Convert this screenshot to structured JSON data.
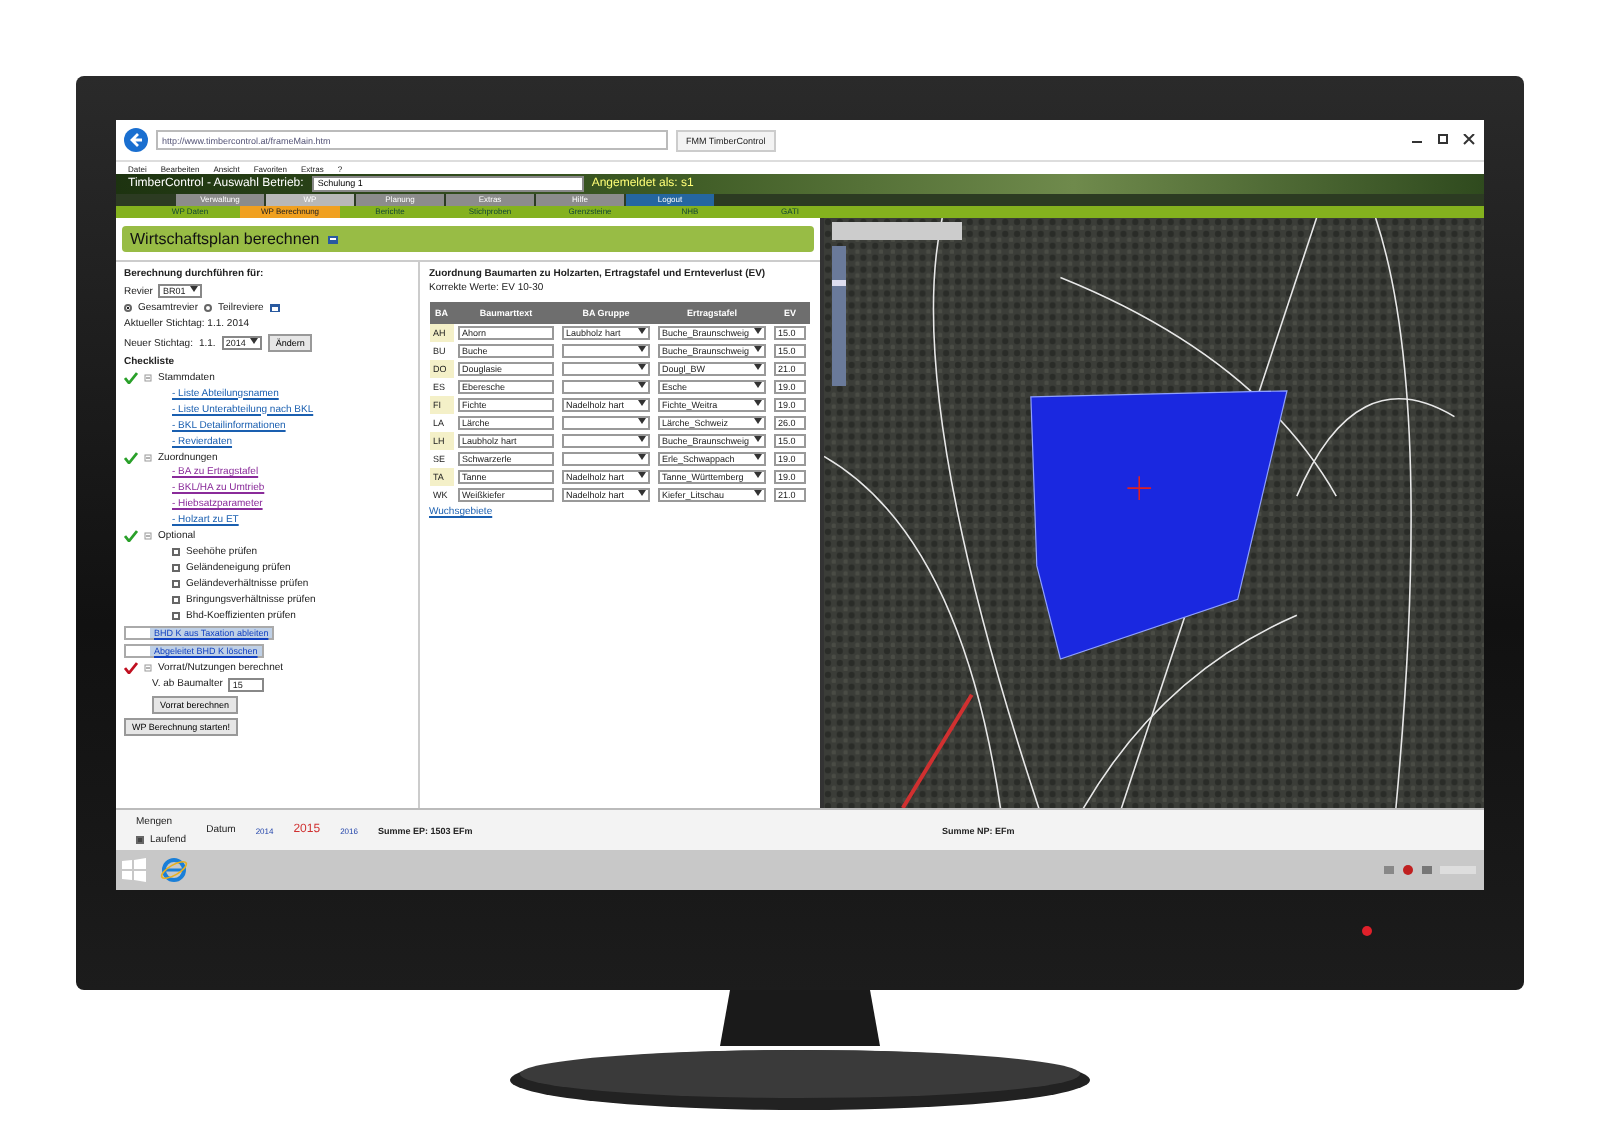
{
  "browser": {
    "address": "http://www.timbercontrol.at/frameMain.htm",
    "tab": "FMM TimberControl"
  },
  "menu": [
    "Datei",
    "Bearbeiten",
    "Ansicht",
    "Favoriten",
    "Extras",
    "?"
  ],
  "header": {
    "label": "TimberControl - Auswahl Betrieb:",
    "company": "Schulung 1",
    "user": "Angemeldet als: s1"
  },
  "nav": [
    {
      "label": "Verwaltung",
      "selected": false
    },
    {
      "label": "WP",
      "selected": true
    },
    {
      "label": "Planung",
      "selected": false
    },
    {
      "label": "Extras",
      "selected": false
    },
    {
      "label": "Hilfe",
      "selected": false
    },
    {
      "label": "Logout",
      "selected": false
    }
  ],
  "subnav": [
    {
      "label": "WP Daten",
      "selected": false
    },
    {
      "label": "WP Berechnung",
      "selected": true
    },
    {
      "label": "Berichte",
      "selected": false
    },
    {
      "label": "Stichproben",
      "selected": false
    },
    {
      "label": "Grenzsteine",
      "selected": false
    },
    {
      "label": "NHB",
      "selected": false
    },
    {
      "label": "GATI",
      "selected": false
    }
  ],
  "page_title": "Wirtschaftsplan berechnen",
  "form": {
    "heading": "Berechnung durchführen für:",
    "revier_label": "Revier",
    "revier": "BR01",
    "scope": [
      {
        "label": "Gesamtrevier",
        "selected": true
      },
      {
        "label": "Teilreviere",
        "selected": false
      }
    ],
    "current_date": "Aktueller Stichtag: 1.1. 2014",
    "new_date_label": "Neuer Stichtag:",
    "new_date_prefix": "1.1.",
    "new_year": "2014",
    "change_button": "Ändern"
  },
  "checklist": {
    "title": "Checkliste",
    "groups": [
      {
        "label": "Stammdaten",
        "ok": true,
        "items": [
          {
            "kind": "link",
            "label": "- Liste Abteilungsnamen"
          },
          {
            "kind": "link",
            "label": "- Liste Unterabteilung nach BKL"
          },
          {
            "kind": "link",
            "label": "- BKL Detailinformationen"
          },
          {
            "kind": "link",
            "label": "- Revierdaten"
          }
        ]
      },
      {
        "label": "Zuordnungen",
        "ok": true,
        "items": [
          {
            "kind": "visited",
            "label": "- BA zu Ertragstafel"
          },
          {
            "kind": "visited",
            "label": "- BKL/HA zu Umtrieb"
          },
          {
            "kind": "visited",
            "label": "- Hiebsatzparameter"
          },
          {
            "kind": "link",
            "label": "- Holzart zu ET"
          }
        ]
      },
      {
        "label": "Optional",
        "ok": true,
        "items": [
          {
            "kind": "checkbox",
            "label": "Seehöhe prüfen",
            "checked": false
          },
          {
            "kind": "checkbox",
            "label": "Geländeneigung prüfen",
            "checked": false
          },
          {
            "kind": "checkbox",
            "label": "Geländeverhältnisse prüfen",
            "checked": false
          },
          {
            "kind": "checkbox",
            "label": "Bringungsverhältnisse prüfen",
            "checked": false
          },
          {
            "kind": "checkbox",
            "label": "Bhd-Koeffizienten prüfen",
            "checked": false
          }
        ]
      }
    ],
    "actions": [
      "BHD K aus Taxation ableiten",
      "Abgeleitet BHD K löschen"
    ],
    "stock": {
      "label": "Vorrat/Nutzungen berechnet",
      "ok": false,
      "age_label": "V. ab Baumalter",
      "age": "15",
      "button": "Vorrat berechnen"
    },
    "start_button": "WP Berechnung starten!"
  },
  "table": {
    "title": "Zuordnung Baumarten zu Holzarten, Ertragstafel und Ernteverlust (EV)",
    "hint": "Korrekte Werte: EV 10-30",
    "columns": [
      "BA",
      "Baumarttext",
      "BA Gruppe",
      "Ertragstafel",
      "EV"
    ],
    "rows": [
      {
        "ba": "AH",
        "text": "Ahorn",
        "group": "Laubholz hart",
        "table": "Buche_Braunschweig",
        "ev": "15.0",
        "highlight": true
      },
      {
        "ba": "BU",
        "text": "Buche",
        "group": "",
        "table": "Buche_Braunschweig",
        "ev": "15.0",
        "highlight": false
      },
      {
        "ba": "DO",
        "text": "Douglasie",
        "group": "",
        "table": "Dougl_BW",
        "ev": "21.0",
        "highlight": true
      },
      {
        "ba": "ES",
        "text": "Eberesche",
        "group": "",
        "table": "Esche",
        "ev": "19.0",
        "highlight": false
      },
      {
        "ba": "FI",
        "text": "Fichte",
        "group": "Nadelholz hart",
        "table": "Fichte_Weitra",
        "ev": "19.0",
        "highlight": true
      },
      {
        "ba": "LA",
        "text": "Lärche",
        "group": "",
        "table": "Lärche_Schweiz",
        "ev": "26.0",
        "highlight": false
      },
      {
        "ba": "LH",
        "text": "Laubholz hart",
        "group": "",
        "table": "Buche_Braunschweig",
        "ev": "15.0",
        "highlight": true
      },
      {
        "ba": "SE",
        "text": "Schwarzerle",
        "group": "",
        "table": "Erle_Schwappach",
        "ev": "19.0",
        "highlight": false
      },
      {
        "ba": "TA",
        "text": "Tanne",
        "group": "Nadelholz hart",
        "table": "Tanne_Württemberg",
        "ev": "19.0",
        "highlight": true
      },
      {
        "ba": "WK",
        "text": "Weißkiefer",
        "group": "Nadelholz hart",
        "table": "Kiefer_Litschau",
        "ev": "21.0",
        "highlight": false
      }
    ],
    "link": "Wuchsgebiete"
  },
  "map": {
    "zoom": {
      "level": 0.75
    }
  },
  "bottom": {
    "mengen": "Mengen",
    "datum": "Datum",
    "laufend": {
      "label": "Laufend",
      "checked": true
    },
    "years": [
      {
        "label": "2014",
        "selected": false
      },
      {
        "label": "2015",
        "selected": true
      },
      {
        "label": "2016",
        "selected": false
      }
    ],
    "sum_ep": "Summe EP: 1503 EFm",
    "sum_np": "Summe NP: EFm"
  }
}
